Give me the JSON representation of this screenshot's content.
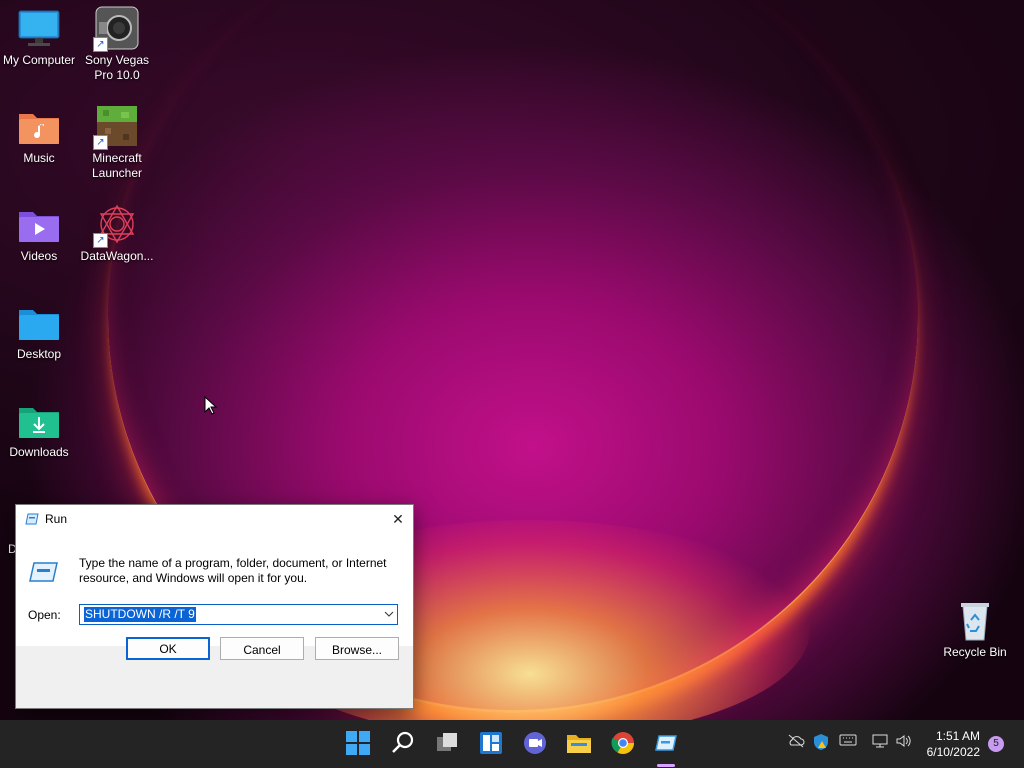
{
  "desktop": {
    "icons": [
      {
        "label": "My Computer"
      },
      {
        "label": "Sony Vegas\nPro 10.0"
      },
      {
        "label": "Music"
      },
      {
        "label": "Minecraft\nLauncher"
      },
      {
        "label": "Videos"
      },
      {
        "label": "DataWagon..."
      },
      {
        "label": "Desktop"
      },
      {
        "label": "Downloads"
      },
      {
        "label": "Recycle Bin"
      }
    ],
    "partial_label": "D"
  },
  "run_dialog": {
    "title": "Run",
    "close_glyph": "✕",
    "description": "Type the name of a program, folder, document, or Internet resource, and Windows will open it for you.",
    "open_label": "Open:",
    "command_value": "SHUTDOWN /R /T 9",
    "ok_label": "OK",
    "cancel_label": "Cancel",
    "browse_label": "Browse..."
  },
  "taskbar": {
    "time": "1:51 AM",
    "date": "6/10/2022",
    "notification_count": "5",
    "icons": [
      "windows-start-icon",
      "search-icon",
      "task-view-icon",
      "widgets-icon",
      "teams-chat-icon",
      "file-explorer-icon",
      "chrome-icon",
      "run-icon"
    ]
  },
  "colors": {
    "accent": "#0a64d6",
    "taskbar": "#242424",
    "badge": "#c69bf0"
  }
}
